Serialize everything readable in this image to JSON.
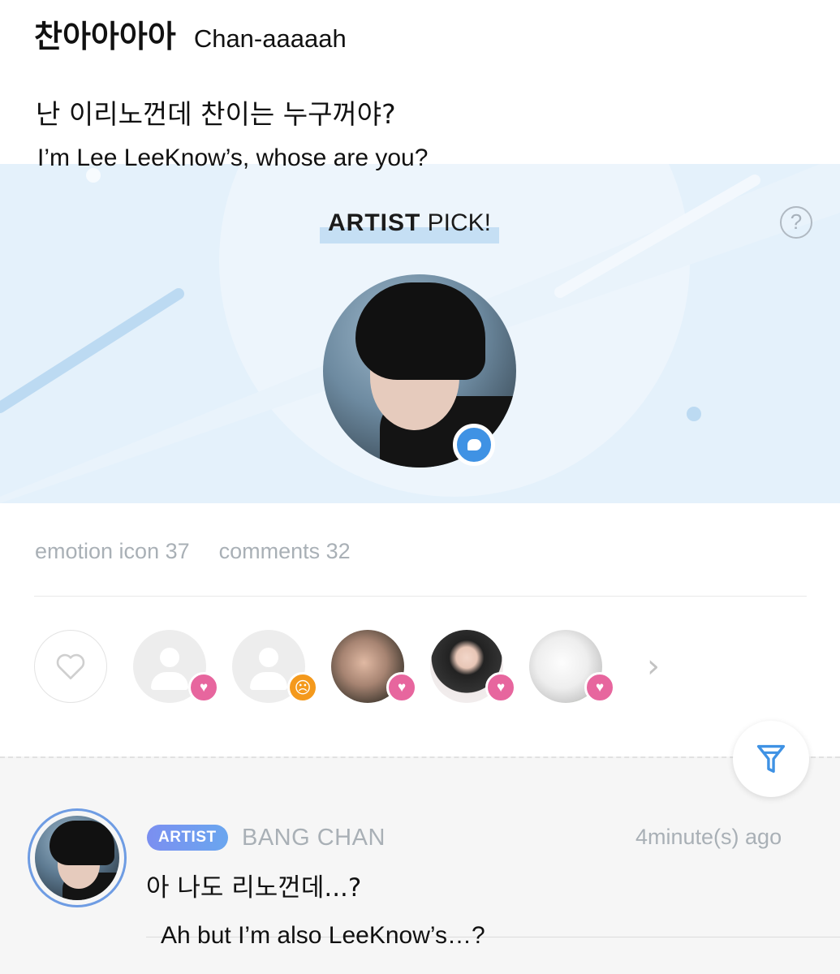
{
  "post": {
    "title_ko": "찬아아아아",
    "title_en": "Chan-aaaaah",
    "body_ko": "난 이리노껀데 찬이는 누구꺼야?",
    "body_en": "I’m Lee LeeKnow’s, whose are you?"
  },
  "artist_pick": {
    "label_bold": "ARTIST",
    "label_rest": " PICK!",
    "help_icon": "?",
    "background_color": "#e4f1fb",
    "badge_color": "#3f92e4"
  },
  "stats": {
    "emotion": "emotion icon 37",
    "comments": "comments 32"
  },
  "reactions": [
    {
      "type": "default-avatar",
      "badge": "heart"
    },
    {
      "type": "default-avatar",
      "badge": "angry"
    },
    {
      "type": "photo",
      "badge": "heart"
    },
    {
      "type": "photo",
      "badge": "heart"
    },
    {
      "type": "photo",
      "badge": "heart"
    }
  ],
  "colors": {
    "heart_badge": "#e7669e",
    "angry_badge": "#f4991c",
    "filter_icon": "#3f92e4",
    "artist_tag_start": "#7b8ff0",
    "artist_tag_end": "#6aa6ef"
  },
  "comment": {
    "tag": "ARTIST",
    "author": "BANG CHAN",
    "time": "4minute(s) ago",
    "text_ko": "아 나도 리노껀데...?",
    "text_en": "Ah but I’m also LeeKnow’s…?"
  }
}
